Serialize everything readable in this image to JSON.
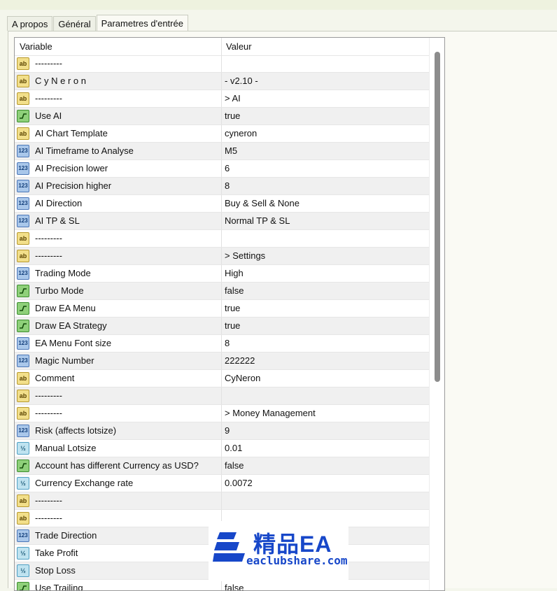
{
  "tabs": [
    {
      "label": "A propos"
    },
    {
      "label": "Général"
    },
    {
      "label": "Parametres d'entrée"
    }
  ],
  "grid": {
    "headers": {
      "variable": "Variable",
      "value": "Valeur"
    },
    "rows": [
      {
        "type": "str",
        "name": "---------",
        "value": ""
      },
      {
        "type": "str",
        "name": " C y N e r o n",
        "value": "-   v2.10  -"
      },
      {
        "type": "str",
        "name": "---------",
        "value": " > AI"
      },
      {
        "type": "bool",
        "name": "Use AI",
        "value": "true"
      },
      {
        "type": "str",
        "name": "AI Chart Template",
        "value": "cyneron"
      },
      {
        "type": "int",
        "name": "AI Timeframe to Analyse",
        "value": "M5"
      },
      {
        "type": "int",
        "name": "AI Precision lower",
        "value": "6"
      },
      {
        "type": "int",
        "name": "AI Precision higher",
        "value": "8"
      },
      {
        "type": "int",
        "name": "AI Direction",
        "value": "Buy & Sell & None"
      },
      {
        "type": "int",
        "name": "AI TP & SL",
        "value": "Normal TP & SL"
      },
      {
        "type": "str",
        "name": "---------",
        "value": ""
      },
      {
        "type": "str",
        "name": "---------",
        "value": " > Settings"
      },
      {
        "type": "int",
        "name": "Trading Mode",
        "value": "High"
      },
      {
        "type": "bool",
        "name": "Turbo Mode",
        "value": "false"
      },
      {
        "type": "bool",
        "name": "Draw EA Menu",
        "value": "true"
      },
      {
        "type": "bool",
        "name": "Draw EA Strategy",
        "value": "true"
      },
      {
        "type": "int",
        "name": "EA Menu Font size",
        "value": "8"
      },
      {
        "type": "int",
        "name": "Magic Number",
        "value": "222222"
      },
      {
        "type": "str",
        "name": "Comment",
        "value": "CyNeron"
      },
      {
        "type": "str",
        "name": "---------",
        "value": ""
      },
      {
        "type": "str",
        "name": "---------",
        "value": " > Money Management"
      },
      {
        "type": "int",
        "name": "Risk (affects lotsize)",
        "value": "9"
      },
      {
        "type": "dbl",
        "name": "Manual Lotsize",
        "value": "0.01"
      },
      {
        "type": "bool",
        "name": "Account has different Currency as USD?",
        "value": "false"
      },
      {
        "type": "dbl",
        "name": "Currency Exchange rate",
        "value": "0.0072"
      },
      {
        "type": "str",
        "name": "---------",
        "value": ""
      },
      {
        "type": "str",
        "name": "---------",
        "value": ""
      },
      {
        "type": "int",
        "name": "Trade Direction",
        "value": ""
      },
      {
        "type": "dbl",
        "name": "Take Profit",
        "value": ""
      },
      {
        "type": "dbl",
        "name": "Stop Loss",
        "value": ""
      },
      {
        "type": "bool",
        "name": "Use Trailing",
        "value": "false"
      }
    ]
  },
  "icon_labels": {
    "str": "ab",
    "int": "123",
    "dbl": "½"
  },
  "watermark": {
    "title": "精品EA",
    "site": "eaclubshare.com",
    "color": "#1747c9"
  }
}
